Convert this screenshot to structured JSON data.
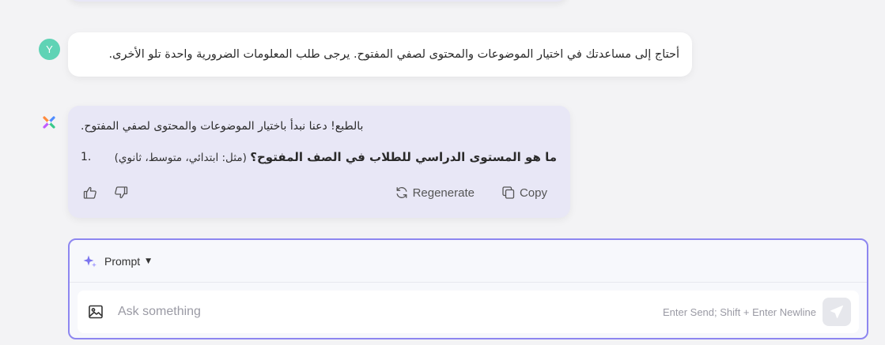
{
  "conversation": {
    "user_message": {
      "avatar_initial": "Y",
      "text": "أحتاج إلى مساعدتك في اختيار الموضوعات والمحتوى لصفي المفتوح. يرجى طلب المعلومات الضرورية واحدة تلو الأخرى."
    },
    "assistant_message": {
      "line1": "بالطبع! دعنا نبدأ باختيار الموضوعات والمحتوى لصفي المفتوح.",
      "question_number": "1.",
      "question_bold": "ما هو المستوى الدراسي للطلاب في الصف المفتوح؟",
      "question_example": "(مثل: ابتدائي، متوسط، ثانوي)",
      "actions": {
        "regenerate_label": "Regenerate",
        "copy_label": "Copy"
      }
    }
  },
  "composer": {
    "mode_label": "Prompt",
    "input_placeholder": "Ask something",
    "input_value": "",
    "hint": "Enter Send; Shift + Enter Newline"
  },
  "icons": {
    "user_avatar": "avatar",
    "assistant_logo": "app-logo-icon",
    "like": "thumbs-up-icon",
    "dislike": "thumbs-down-icon",
    "regenerate": "refresh-icon",
    "copy": "copy-icon",
    "prompt": "sparkle-icon",
    "prompt_dropdown": "caret-down-icon",
    "image": "image-icon",
    "send": "send-icon"
  },
  "colors": {
    "accent": "#8d86f0",
    "user_avatar_bg": "#5fd3b5",
    "assistant_bubble_bg": "#e8e7f6"
  }
}
